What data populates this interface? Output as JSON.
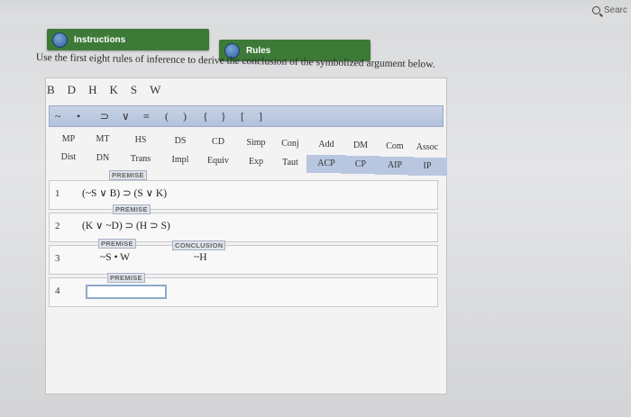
{
  "browser": {
    "search_label": "Searc"
  },
  "tabs": {
    "instructions": "Instructions",
    "rules": "Rules"
  },
  "instruction_text": "Use the first eight rules of inference to derive the conclusion of the symbolized argument below.",
  "letters": [
    "B",
    "D",
    "H",
    "K",
    "S",
    "W"
  ],
  "symbols": [
    "~",
    "•",
    "⊃",
    "∨",
    "≡",
    "(",
    ")",
    "{",
    "}",
    "[",
    "]"
  ],
  "rules_row1": [
    "MP",
    "MT",
    "HS",
    "DS",
    "CD",
    "Simp",
    "Conj",
    "Add",
    "DM",
    "Com",
    "Assoc"
  ],
  "rules_row2": [
    "Dist",
    "DN",
    "Trans",
    "Impl",
    "Equiv",
    "Exp",
    "Taut",
    "ACP",
    "CP",
    "AIP",
    "IP"
  ],
  "lines": [
    {
      "num": "1",
      "tag": "PREMISE",
      "formula": "(~S ∨ B) ⊃ (S ∨ K)"
    },
    {
      "num": "2",
      "tag": "PREMISE",
      "formula": "(K ∨ ~D) ⊃ (H ⊃ S)"
    },
    {
      "num": "3",
      "tag": "PREMISE",
      "formula": "~S • W",
      "conclusion_tag": "CONCLUSION",
      "conclusion": "~H"
    },
    {
      "num": "4",
      "tag": "PREMISE",
      "formula": ""
    }
  ],
  "colors": {
    "tab_green": "#3e7a37",
    "toolbar_blue": "#b8c6e0"
  }
}
